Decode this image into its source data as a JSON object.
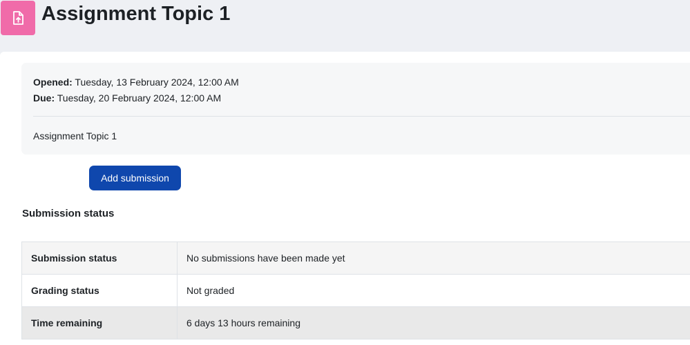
{
  "header": {
    "title": "Assignment Topic 1",
    "icon": "assignment-upload-icon",
    "icon_color": "#f06ba9"
  },
  "dates": {
    "opened_label": "Opened:",
    "opened_value": "Tuesday, 13 February 2024, 12:00 AM",
    "due_label": "Due:",
    "due_value": "Tuesday, 20 February 2024, 12:00 AM"
  },
  "intro": {
    "text": "Assignment Topic 1"
  },
  "actions": {
    "add_submission_label": "Add submission",
    "button_color": "#0f47ad"
  },
  "submission_status": {
    "heading": "Submission status",
    "rows": [
      {
        "label": "Submission status",
        "value": "No submissions have been made yet"
      },
      {
        "label": "Grading status",
        "value": "Not graded"
      },
      {
        "label": "Time remaining",
        "value": "6 days 13 hours remaining"
      }
    ]
  }
}
